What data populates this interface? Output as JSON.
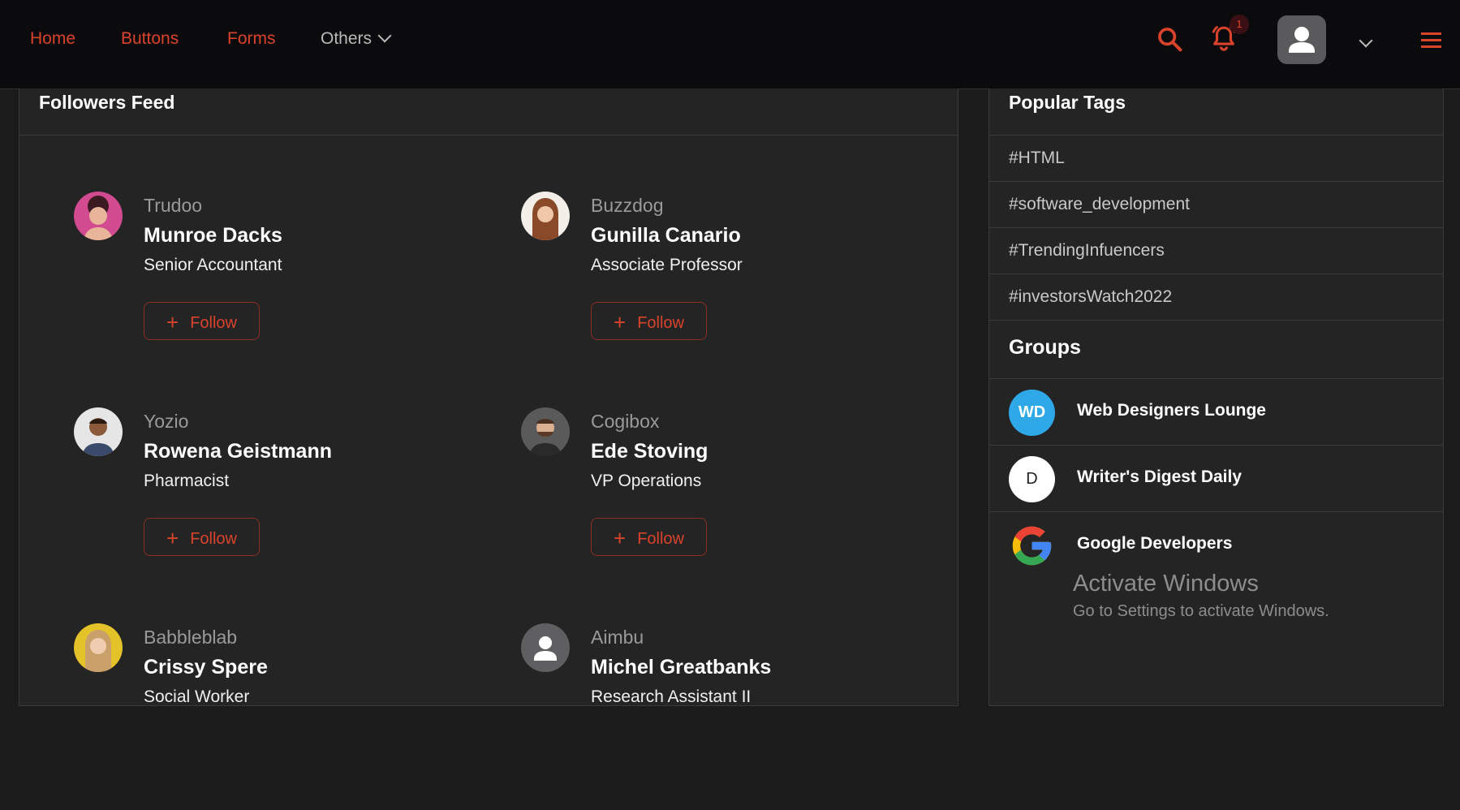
{
  "nav": {
    "links": [
      "Home",
      "Buttons",
      "Forms"
    ],
    "others_label": "Others",
    "notification_count": "1"
  },
  "colors": {
    "accent": "#d9432c",
    "background": "#1b1b1b",
    "panel": "#242424",
    "topbar": "#0b0b0d"
  },
  "feed": {
    "title": "Followers Feed",
    "follow_label": "Follow",
    "people": [
      {
        "company": "Trudoo",
        "name": "Munroe Dacks",
        "role": "Senior Accountant"
      },
      {
        "company": "Buzzdog",
        "name": "Gunilla Canario",
        "role": "Associate Professor"
      },
      {
        "company": "Yozio",
        "name": "Rowena Geistmann",
        "role": "Pharmacist"
      },
      {
        "company": "Cogibox",
        "name": "Ede Stoving",
        "role": "VP Operations"
      },
      {
        "company": "Babbleblab",
        "name": "Crissy Spere",
        "role": "Social Worker"
      },
      {
        "company": "Aimbu",
        "name": "Michel Greatbanks",
        "role": "Research Assistant II"
      }
    ]
  },
  "sidebar": {
    "tags_title": "Popular Tags",
    "tags": [
      "#HTML",
      "#software_development",
      "#TrendingInfuencers",
      "#investorsWatch2022"
    ],
    "groups_title": "Groups",
    "groups": [
      {
        "initials": "WD",
        "name": "Web Designers Lounge"
      },
      {
        "initials": "D",
        "name": "Writer's Digest Daily"
      },
      {
        "initials": "",
        "name": "Google Developers"
      }
    ]
  },
  "watermark": {
    "title": "Activate Windows",
    "subtitle": "Go to Settings to activate Windows."
  }
}
